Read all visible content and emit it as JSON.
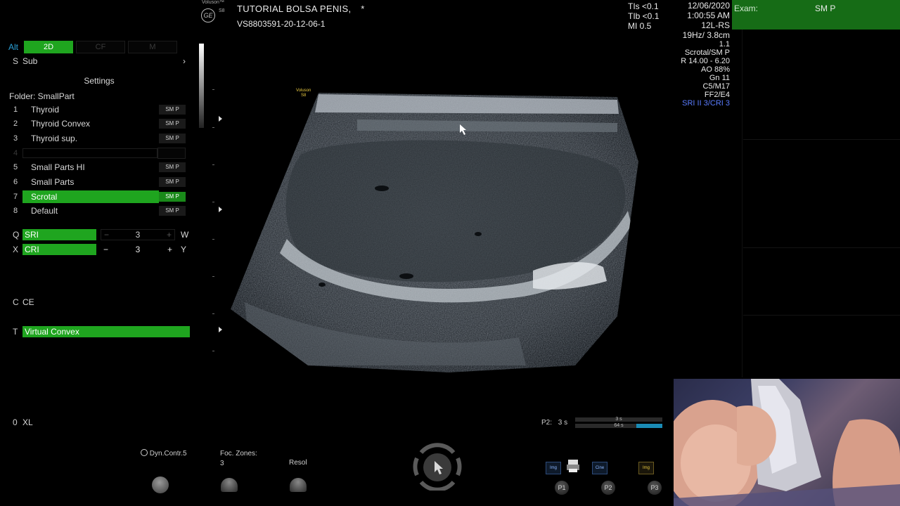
{
  "header": {
    "voluson_label": "Voluson™",
    "ge_label": "GE",
    "model_label": "S8",
    "title": "TUTORIAL BOLSA PENIS,",
    "title_marker": "*",
    "patient_id": "VS8803591-20-12-06-1",
    "tis": "TIs <0.1",
    "tib": "TIb <0.1",
    "mi": "MI  0.5",
    "date": "12/06/2020",
    "time": "1:00:55 AM",
    "probe": "12L-RS",
    "freq_depth": "19Hz/ 3.8cm",
    "param_1": "1.1",
    "preset_app": "Scrotal/SM P",
    "range": "R 14.00 - 6.20",
    "ao": "AO 88%",
    "gain": "Gn  11",
    "c_m": "C5/M17",
    "ff": "FF2/E4",
    "sri_cri": "SRI II 3/CRI 3"
  },
  "exam": {
    "label": "Exam:",
    "value": "SM P"
  },
  "left_panel": {
    "alt_label": "Alt",
    "modes": [
      {
        "label": "2D"
      },
      {
        "label": "CF"
      },
      {
        "label": "M"
      }
    ],
    "sub_key": "S",
    "sub_label": "Sub",
    "sub_arrow": "›",
    "settings_label": "Settings",
    "folder_label": "Folder: SmallPart",
    "presets": [
      {
        "num": "1",
        "name": "Thyroid",
        "tag": "SM P"
      },
      {
        "num": "2",
        "name": "Thyroid Convex",
        "tag": "SM P"
      },
      {
        "num": "3",
        "name": "Thyroid sup.",
        "tag": "SM P"
      },
      {
        "num": "4",
        "name": "",
        "tag": ""
      },
      {
        "num": "5",
        "name": "Small Parts HI",
        "tag": "SM P"
      },
      {
        "num": "6",
        "name": "Small Parts",
        "tag": "SM P"
      },
      {
        "num": "7",
        "name": "Scrotal",
        "tag": "SM P"
      },
      {
        "num": "8",
        "name": "Default",
        "tag": "SM P"
      }
    ],
    "sri": {
      "key": "Q",
      "label": "SRI",
      "minus": "−",
      "value": "3",
      "plus": "+",
      "side": "W"
    },
    "cri": {
      "key": "X",
      "label": "CRI",
      "minus": "−",
      "value": "3",
      "plus": "+",
      "side": "Y"
    },
    "ce": {
      "key": "C",
      "label": "CE"
    },
    "virtual": {
      "key": "T",
      "label": "Virtual Convex"
    },
    "xl": {
      "key": "0",
      "label": "XL"
    }
  },
  "image_labels": {
    "voluson": "Voluson",
    "model": "S8"
  },
  "bottom": {
    "dyn_contr": "Dyn.Contr.5",
    "foc_zones_label": "Foc. Zones:",
    "foc_zones_value": "3",
    "resol": "Resol",
    "p2_label": "P2:",
    "p2_value": "3 s",
    "cine_top": "3 s",
    "cine_bottom": "64 s",
    "icons": [
      "Img",
      "Cine",
      "Img"
    ],
    "p1": "P1",
    "p2": "P2",
    "p3": "P3"
  }
}
